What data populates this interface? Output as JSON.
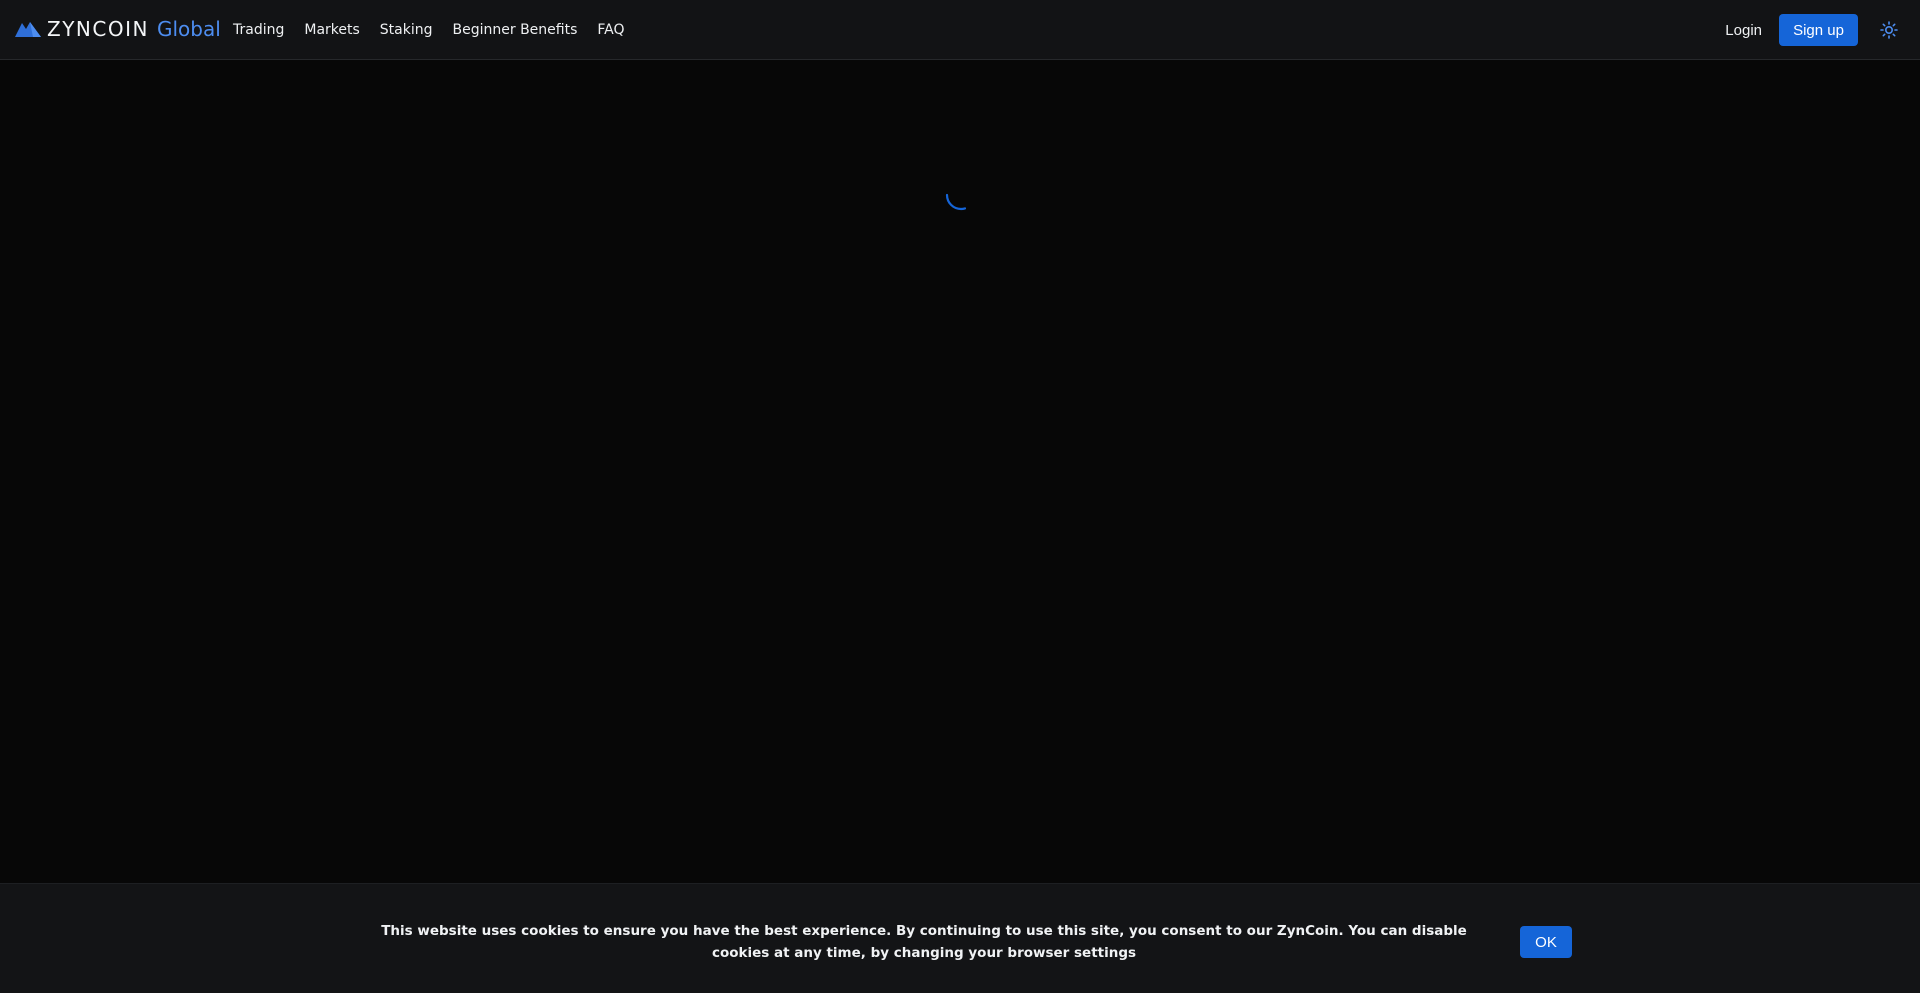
{
  "header": {
    "brand": {
      "name": "ZYNCOIN",
      "accent": "Global",
      "icon": "mountain-logo-icon"
    },
    "nav": [
      {
        "label": "Trading"
      },
      {
        "label": "Markets"
      },
      {
        "label": "Staking"
      },
      {
        "label": "Beginner Benefits"
      },
      {
        "label": "FAQ"
      }
    ],
    "login_label": "Login",
    "signup_label": "Sign up",
    "theme_icon": "sun-icon"
  },
  "main": {
    "loading_icon": "spinner-icon"
  },
  "cookie": {
    "text": "This website uses cookies to ensure you have the best experience. By continuing to use this site, you consent to our ZynCoin. You can disable cookies at any time, by changing your browser settings",
    "ok_label": "OK"
  },
  "colors": {
    "accent": "#1565d8",
    "brand_accent": "#4d8df0",
    "header_bg": "#121315",
    "page_bg": "#070707",
    "cookie_bg": "#131416"
  }
}
